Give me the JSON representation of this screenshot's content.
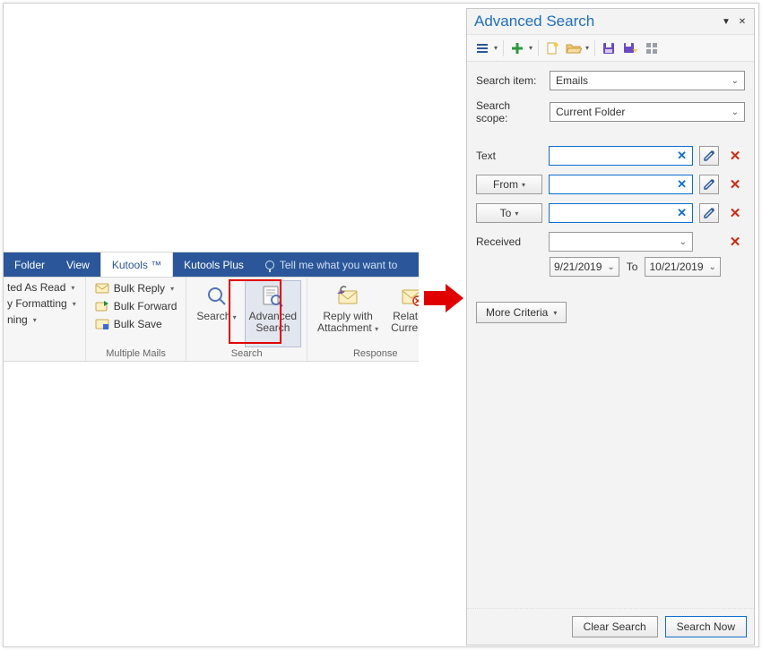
{
  "ribbon": {
    "tabs": [
      "Folder",
      "View",
      "Kutools ™",
      "Kutools Plus"
    ],
    "tellme": "Tell me what you want to",
    "group1": {
      "label": "",
      "items": [
        "ted As Read",
        "y Formatting",
        "ning"
      ]
    },
    "group2": {
      "label": "Multiple Mails",
      "items": [
        "Bulk Reply",
        "Bulk Forward",
        "Bulk Save"
      ]
    },
    "group3": {
      "label": "Search",
      "btns": [
        {
          "line1": "Search",
          "line2": ""
        },
        {
          "line1": "Advanced",
          "line2": "Search"
        }
      ]
    },
    "group4": {
      "label": "Response",
      "btns": [
        {
          "line1": "Reply with",
          "line2": "Attachment"
        },
        {
          "line1": "Relative",
          "line2": "Current"
        }
      ]
    }
  },
  "panel": {
    "title": "Advanced Search",
    "search_item_label": "Search item:",
    "search_item_value": "Emails",
    "search_scope_label": "Search scope:",
    "search_scope_value": "Current Folder",
    "fields": {
      "text_label": "Text",
      "from_label": "From",
      "to_label": "To",
      "received_label": "Received",
      "date_from": "9/21/2019",
      "date_sep": "To",
      "date_to": "10/21/2019"
    },
    "more_criteria": "More Criteria",
    "clear": "Clear Search",
    "search_now": "Search Now"
  }
}
